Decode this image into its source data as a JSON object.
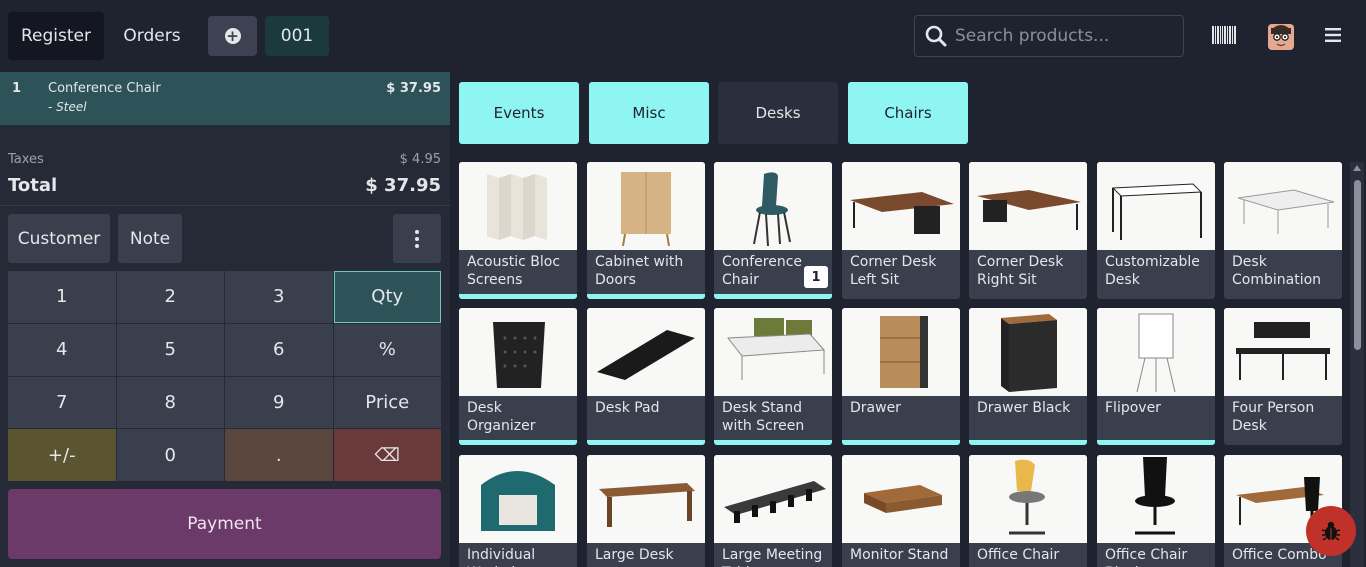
{
  "header": {
    "register_label": "Register",
    "orders_label": "Orders",
    "order_number": "001",
    "search_placeholder": "Search products..."
  },
  "order": {
    "line": {
      "qty": "1",
      "name": "Conference Chair",
      "variant": "- Steel",
      "price": "$ 37.95"
    },
    "taxes_label": "Taxes",
    "taxes_value": "$ 4.95",
    "total_label": "Total",
    "total_value": "$ 37.95"
  },
  "actions": {
    "customer_label": "Customer",
    "note_label": "Note"
  },
  "numpad": [
    "1",
    "2",
    "3",
    "Qty",
    "4",
    "5",
    "6",
    "%",
    "7",
    "8",
    "9",
    "Price",
    "+/-",
    "0",
    ".",
    "⌫"
  ],
  "payment_label": "Payment",
  "categories": [
    {
      "label": "Events",
      "active": true
    },
    {
      "label": "Misc",
      "active": true
    },
    {
      "label": "Desks",
      "active": false
    },
    {
      "label": "Chairs",
      "active": true
    }
  ],
  "products": [
    {
      "name": "Acoustic Bloc Screens",
      "bar": true
    },
    {
      "name": "Cabinet with Doors",
      "bar": true
    },
    {
      "name": "Conference Chair",
      "bar": true,
      "badge": "1"
    },
    {
      "name": "Corner Desk Left Sit",
      "bar": false
    },
    {
      "name": "Corner Desk Right Sit",
      "bar": false
    },
    {
      "name": "Customizable Desk",
      "bar": false
    },
    {
      "name": "Desk Combination",
      "bar": false
    },
    {
      "name": "Desk Organizer",
      "bar": true
    },
    {
      "name": "Desk Pad",
      "bar": true
    },
    {
      "name": "Desk Stand with Screen",
      "bar": true
    },
    {
      "name": "Drawer",
      "bar": true
    },
    {
      "name": "Drawer Black",
      "bar": true
    },
    {
      "name": "Flipover",
      "bar": true
    },
    {
      "name": "Four Person Desk",
      "bar": false
    },
    {
      "name": "Individual Workplace",
      "bar": false
    },
    {
      "name": "Large Desk",
      "bar": false
    },
    {
      "name": "Large Meeting Table",
      "bar": false
    },
    {
      "name": "Monitor Stand",
      "bar": false
    },
    {
      "name": "Office Chair",
      "bar": false
    },
    {
      "name": "Office Chair Black",
      "bar": false
    },
    {
      "name": "Office Combo",
      "bar": false
    }
  ],
  "colors": {
    "accent": "#8ff5f3",
    "payment": "#6b3a69",
    "selected_line": "#2d5358"
  }
}
